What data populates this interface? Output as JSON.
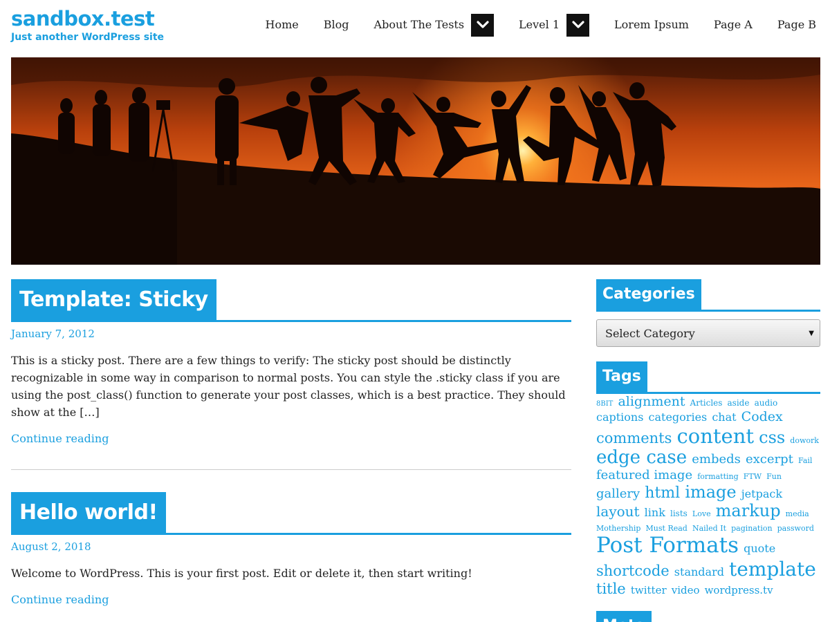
{
  "site": {
    "title": "sandbox.test",
    "description": "Just another WordPress site"
  },
  "nav": {
    "items": [
      {
        "label": "Home",
        "has_submenu": false
      },
      {
        "label": "Blog",
        "has_submenu": false
      },
      {
        "label": "About The Tests",
        "has_submenu": true
      },
      {
        "label": "Level 1",
        "has_submenu": true
      },
      {
        "label": "Lorem Ipsum",
        "has_submenu": false
      },
      {
        "label": "Page A",
        "has_submenu": false
      },
      {
        "label": "Page B",
        "has_submenu": false
      }
    ],
    "toggle_icon": "chevron-down-icon"
  },
  "hero": {
    "alt_icon": "sunset-silhouette-image"
  },
  "posts": [
    {
      "title": "Template: Sticky",
      "date": "January 7, 2012",
      "summary": "This is a sticky post. There are a few things to verify: The sticky post should be distinctly recognizable in some way in comparison to normal posts. You can style the .sticky class if you are using the post_class() function to generate your post classes, which is a best practice. They should show at the […]",
      "more": "Continue reading"
    },
    {
      "title": "Hello world!",
      "date": "August 2, 2018",
      "summary": "Welcome to WordPress. This is your first post. Edit or delete it, then start writing!",
      "more": "Continue reading"
    }
  ],
  "sidebar": {
    "categories": {
      "title": "Categories",
      "select_value": "Select Category"
    },
    "tags": {
      "title": "Tags",
      "items": [
        {
          "label": "8BIT",
          "size": 10
        },
        {
          "label": "alignment",
          "size": 19
        },
        {
          "label": "Articles",
          "size": 12
        },
        {
          "label": "aside",
          "size": 12
        },
        {
          "label": "audio",
          "size": 12
        },
        {
          "label": "captions",
          "size": 16
        },
        {
          "label": "categories",
          "size": 16
        },
        {
          "label": "chat",
          "size": 16
        },
        {
          "label": "Codex",
          "size": 19
        },
        {
          "label": "comments",
          "size": 21
        },
        {
          "label": "content",
          "size": 29
        },
        {
          "label": "css",
          "size": 24
        },
        {
          "label": "dowork",
          "size": 11
        },
        {
          "label": "edge case",
          "size": 26
        },
        {
          "label": "embeds",
          "size": 18
        },
        {
          "label": "excerpt",
          "size": 18
        },
        {
          "label": "Fail",
          "size": 11
        },
        {
          "label": "featured image",
          "size": 18
        },
        {
          "label": "formatting",
          "size": 11
        },
        {
          "label": "FTW",
          "size": 11
        },
        {
          "label": "Fun",
          "size": 11
        },
        {
          "label": "gallery",
          "size": 18
        },
        {
          "label": "html",
          "size": 22
        },
        {
          "label": "image",
          "size": 24
        },
        {
          "label": "jetpack",
          "size": 16
        },
        {
          "label": "layout",
          "size": 20
        },
        {
          "label": "link",
          "size": 16
        },
        {
          "label": "lists",
          "size": 12
        },
        {
          "label": "Love",
          "size": 11
        },
        {
          "label": "markup",
          "size": 24
        },
        {
          "label": "media",
          "size": 11
        },
        {
          "label": "Mothership",
          "size": 11
        },
        {
          "label": "Must Read",
          "size": 11
        },
        {
          "label": "Nailed It",
          "size": 11
        },
        {
          "label": "pagination",
          "size": 11
        },
        {
          "label": "password",
          "size": 11
        },
        {
          "label": "Post Formats",
          "size": 31
        },
        {
          "label": "quote",
          "size": 16
        },
        {
          "label": "shortcode",
          "size": 21
        },
        {
          "label": "standard",
          "size": 16
        },
        {
          "label": "template",
          "size": 28
        },
        {
          "label": "title",
          "size": 21
        },
        {
          "label": "twitter",
          "size": 15
        },
        {
          "label": "video",
          "size": 15
        },
        {
          "label": "wordpress.tv",
          "size": 15
        }
      ]
    },
    "meta": {
      "title": "Meta"
    }
  },
  "colors": {
    "accent": "#1a9fdf",
    "text": "#222222",
    "toggle_bg": "#111111"
  }
}
